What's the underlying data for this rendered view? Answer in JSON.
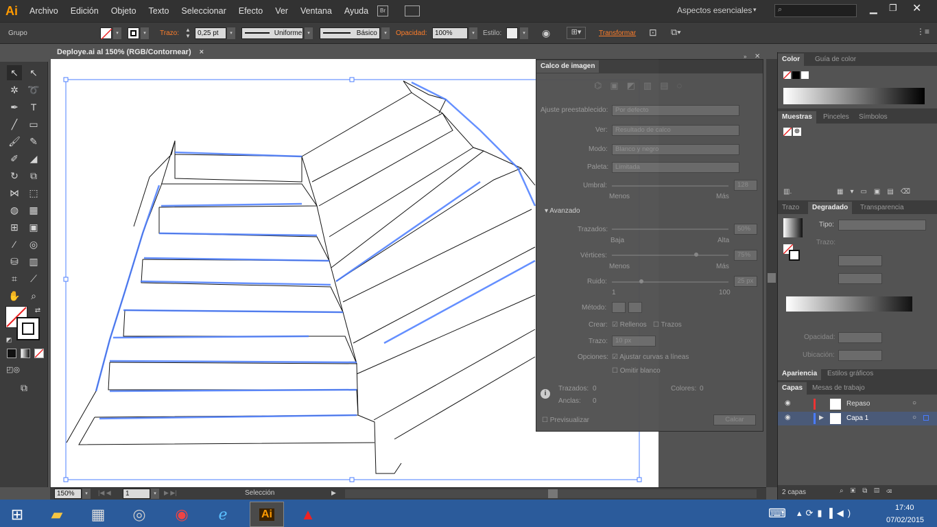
{
  "app": {
    "logo": "Ai",
    "workspace": "Aspectos esenciales"
  },
  "menu": [
    "Archivo",
    "Edición",
    "Objeto",
    "Texto",
    "Seleccionar",
    "Efecto",
    "Ver",
    "Ventana",
    "Ayuda"
  ],
  "control": {
    "selection_label": "Grupo",
    "stroke_label": "Trazo:",
    "stroke_value": "0,25 pt",
    "profile": "Uniforme",
    "brush": "Básico",
    "opacity_label": "Opacidad:",
    "opacity_value": "100%",
    "style_label": "Estilo:",
    "transform_label": "Transformar"
  },
  "document": {
    "tab_title": "Deploye.ai al 150% (RGB/Contornear)",
    "close": "×"
  },
  "status": {
    "zoom": "150%",
    "artboard": "1",
    "tool": "Selección"
  },
  "trace": {
    "title": "Calco de imagen",
    "preset_label": "Ajuste preestablecido:",
    "preset_value": "Por defecto",
    "view_label": "Ver:",
    "view_value": "Resultado de calco",
    "mode_label": "Modo:",
    "mode_value": "Blanco y negro",
    "palette_label": "Paleta:",
    "palette_value": "Limitada",
    "threshold_label": "Umbral:",
    "threshold_value": "128",
    "threshold_min": "Menos",
    "threshold_max": "Más",
    "advanced": "Avanzado",
    "paths_label": "Trazados:",
    "paths_value": "50%",
    "paths_min": "Baja",
    "paths_max": "Alta",
    "corners_label": "Vértices:",
    "corners_value": "75%",
    "corners_min": "Menos",
    "corners_max": "Más",
    "noise_label": "Ruido:",
    "noise_value": "25 px",
    "noise_min": "1",
    "noise_max": "100",
    "method_label": "Método:",
    "create_label": "Crear:",
    "fill_opt": "Rellenos",
    "stroke_opt": "Trazos",
    "stroke_label": "Trazo:",
    "stroke_value": "10 px",
    "options_label": "Opciones:",
    "fit_opt": "Ajustar curvas a líneas",
    "ignore_white": "Omitir blanco",
    "stat_paths": "Trazados:",
    "stat_paths_val": "0",
    "stat_colors": "Colores:",
    "stat_colors_val": "0",
    "stat_anchors": "Anclas:",
    "stat_anchors_val": "0",
    "preview": "Previsualizar",
    "trace_btn": "Calcar"
  },
  "panels": {
    "color_tabs": [
      "Color",
      "Guía de color"
    ],
    "swatch_tabs": [
      "Muestras",
      "Pinceles",
      "Símbolos"
    ],
    "gradient_tabs": [
      "Trazo",
      "Degradado",
      "Transparencia"
    ],
    "gradient": {
      "type_label": "Tipo:",
      "stroke_label": "Trazo:",
      "opacity_label": "Opacidad:",
      "location_label": "Ubicación:"
    },
    "appearance_tabs": [
      "Apariencia",
      "Estilos gráficos"
    ],
    "layers_tabs": [
      "Capas",
      "Mesas de trabajo"
    ],
    "layers": [
      {
        "name": "Repaso",
        "color": "#e33"
      },
      {
        "name": "Capa 1",
        "color": "#4a7cff"
      }
    ],
    "layers_count": "2 capas"
  },
  "taskbar": {
    "time": "17:40",
    "date": "07/02/2015"
  },
  "chart_colors": {
    "accent": "#ff9a00",
    "selection": "#4a7cff"
  }
}
